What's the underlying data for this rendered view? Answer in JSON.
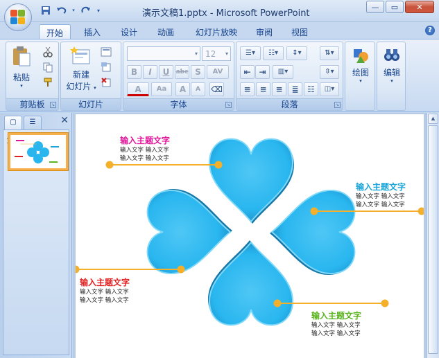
{
  "window": {
    "title": "演示文稿1.pptx - Microsoft PowerPoint",
    "minimize": "—",
    "restore": "▭",
    "close": "✕"
  },
  "qat": {
    "save_icon": "save-icon",
    "undo_icon": "undo-icon",
    "redo_icon": "redo-icon",
    "customize_icon": "dropdown-icon"
  },
  "tabs": [
    {
      "label": "开始",
      "active": true
    },
    {
      "label": "插入"
    },
    {
      "label": "设计"
    },
    {
      "label": "动画"
    },
    {
      "label": "幻灯片放映"
    },
    {
      "label": "审阅"
    },
    {
      "label": "视图"
    }
  ],
  "ribbon": {
    "clipboard": {
      "paste_label": "粘贴",
      "group_label": "剪贴板"
    },
    "slides": {
      "new_slide_label1": "新建",
      "new_slide_label2": "幻灯片",
      "group_label": "幻灯片"
    },
    "font": {
      "font_name": "",
      "font_size": "12",
      "group_label": "字体",
      "bold": "B",
      "italic": "I",
      "underline": "U",
      "strike": "abc",
      "shadow": "S",
      "spacing": "AV",
      "color": "A",
      "case": "Aa",
      "grow": "A",
      "shrink": "A"
    },
    "paragraph": {
      "group_label": "段落"
    },
    "drawing": {
      "label": "绘图"
    },
    "editing": {
      "label": "编辑"
    }
  },
  "slide_panel": {
    "thumb_number": "1"
  },
  "slide": {
    "callouts": [
      {
        "title": "输入主题文字",
        "title_color": "#e0179a",
        "line1": "输入文字  输入文字",
        "line2": "输入文字  输入文字"
      },
      {
        "title": "输入主题文字",
        "title_color": "#1aa4d8",
        "line1": "输入文字  输入文字",
        "line2": "输入文字  输入文字"
      },
      {
        "title": "输入主题文字",
        "title_color": "#e02020",
        "line1": "输入文字  输入文字",
        "line2": "输入文字  输入文字"
      },
      {
        "title": "输入主题文字",
        "title_color": "#5ab320",
        "line1": "输入文字  输入文字",
        "line2": "输入文字  输入文字"
      }
    ],
    "heart_color": "#29b6ef",
    "connector_color": "#f4b02a"
  }
}
